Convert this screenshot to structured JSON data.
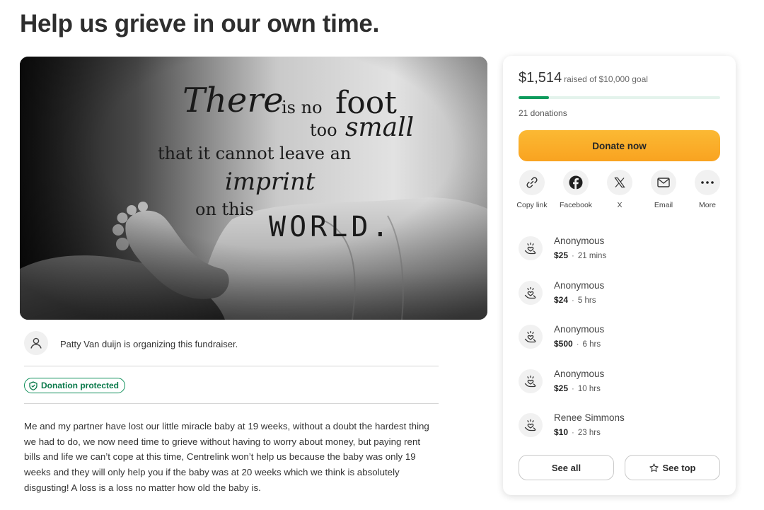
{
  "page": {
    "title": "Help us grieve in our own time."
  },
  "hero_image": {
    "quote": {
      "line1_script": "There",
      "line1_rest": "is no",
      "line1_big": "foot",
      "line2": "too",
      "line2_script": "small",
      "line3": "that it cannot leave an",
      "line4_script": "imprint",
      "line5": "on this",
      "line5_big": "WORLD."
    }
  },
  "organizer": {
    "text": "Patty Van duijn is organizing this fundraiser.",
    "icon": "user-icon"
  },
  "badge": {
    "label": "Donation protected",
    "icon": "shield-icon",
    "color": "#0e8f5a"
  },
  "story": {
    "text": "Me and my partner have lost our little miracle baby at 19 weeks, without a doubt the hardest thing we had to do, we now need time to grieve without having to worry about money, but paying rent bills and life we can’t cope at this time, Centrelink won’t help us because the baby was only 19 weeks and they will only help you if the baby was at 20 weeks which we think is absolutely disgusting! A loss is a loss no matter how old the baby is."
  },
  "summary": {
    "raised": "$1,514",
    "goal_text": "raised of $10,000 goal",
    "progress_fraction": 0.1514,
    "donations": "21 donations",
    "progress_color": "#0e9b5d"
  },
  "donate": {
    "label": "Donate now",
    "color": "#f9a320"
  },
  "share": [
    {
      "label": "Copy link",
      "icon": "link-icon"
    },
    {
      "label": "Facebook",
      "icon": "facebook-icon"
    },
    {
      "label": "X",
      "icon": "x-logo-icon"
    },
    {
      "label": "Email",
      "icon": "mail-icon"
    },
    {
      "label": "More",
      "icon": "more-icon"
    }
  ],
  "donors": [
    {
      "name": "Anonymous",
      "amount": "$25",
      "time": "21 mins"
    },
    {
      "name": "Anonymous",
      "amount": "$24",
      "time": "5 hrs"
    },
    {
      "name": "Anonymous",
      "amount": "$500",
      "time": "6 hrs"
    },
    {
      "name": "Anonymous",
      "amount": "$25",
      "time": "10 hrs"
    },
    {
      "name": "Renee Simmons",
      "amount": "$10",
      "time": "23 hrs"
    }
  ],
  "buttons": {
    "see_all": "See all",
    "see_top": "See top"
  }
}
